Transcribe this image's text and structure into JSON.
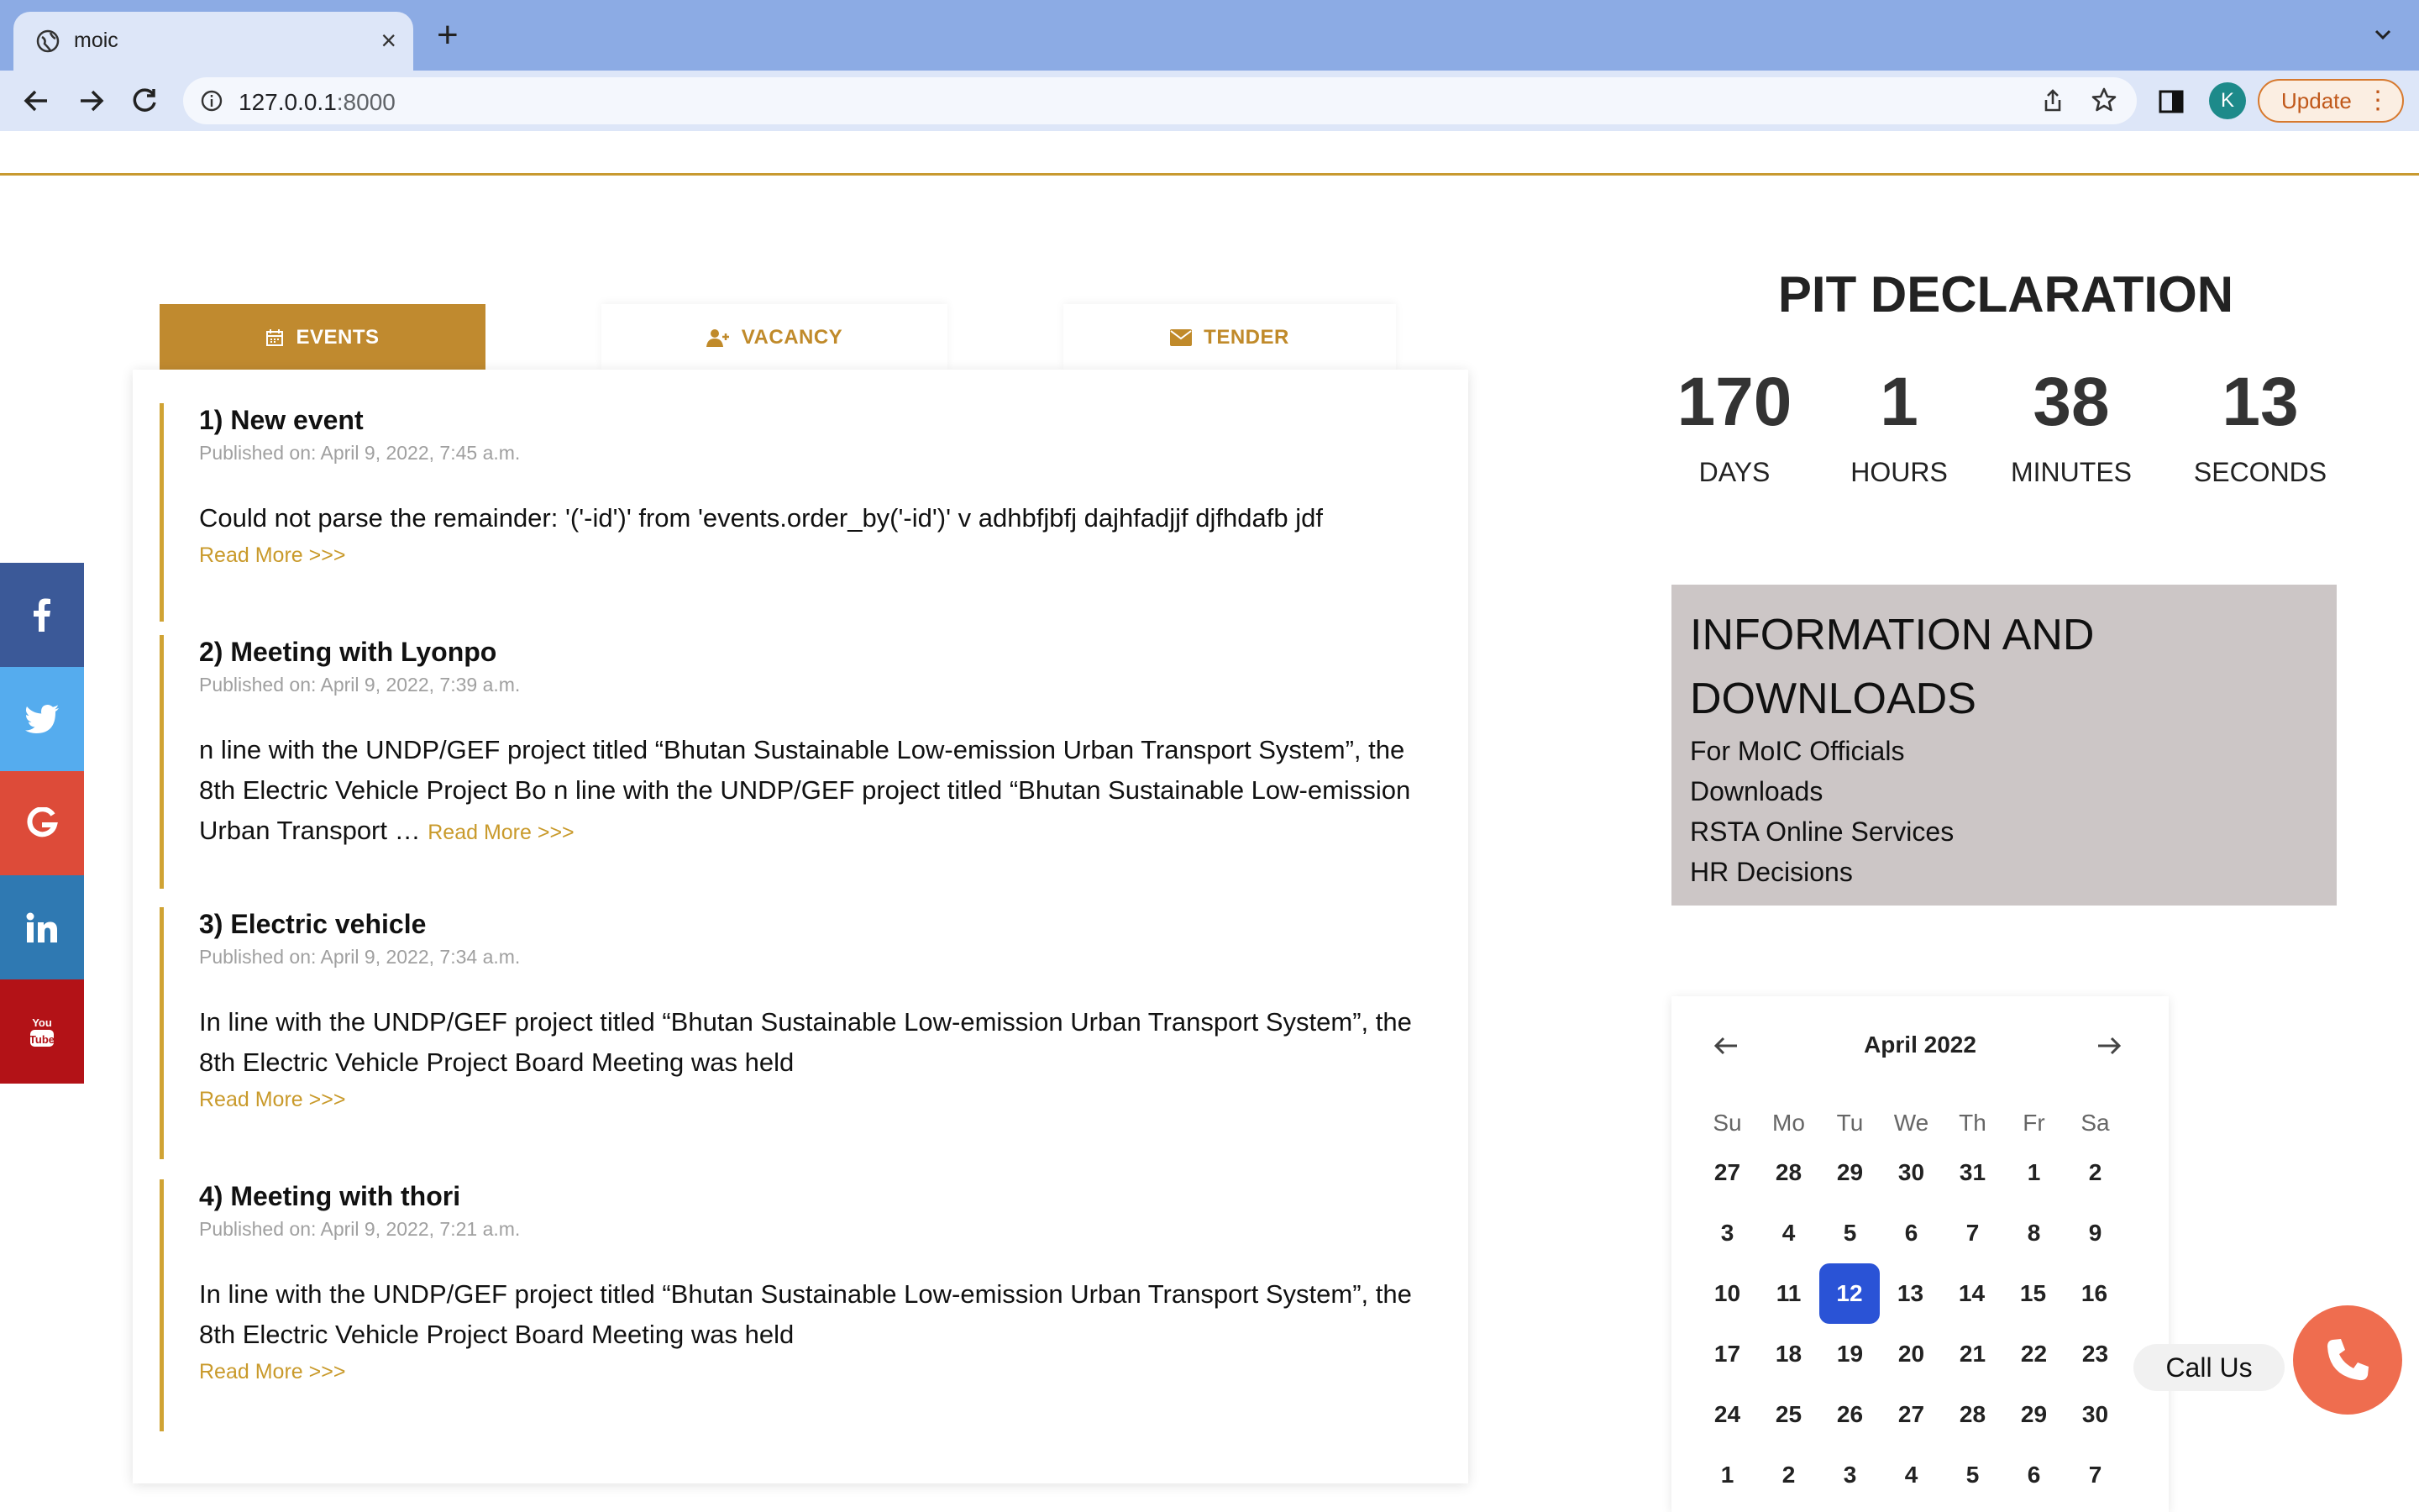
{
  "browser": {
    "tab_title": "moic",
    "url_host": "127.0.0.1",
    "url_port": ":8000",
    "avatar_letter": "K",
    "update_label": "Update"
  },
  "tabs": [
    {
      "label": "EVENTS",
      "icon": "calendar-icon",
      "active": true
    },
    {
      "label": "VACANCY",
      "icon": "user-plus-icon",
      "active": false
    },
    {
      "label": "TENDER",
      "icon": "envelope-icon",
      "active": false
    }
  ],
  "events": [
    {
      "title": "1) New event",
      "published": "Published on: April 9, 2022, 7:45 a.m.",
      "body": "Could not parse the remainder: '('-id')' from 'events.order_by('-id')' v adhbfjbfj dajhfadjjf djfhdafb jdf",
      "read_more": "Read More >>>"
    },
    {
      "title": "2) Meeting with Lyonpo",
      "published": "Published on: April 9, 2022, 7:39 a.m.",
      "body": "n line with the UNDP/GEF project titled “Bhutan Sustainable Low-emission Urban Transport System”, the 8th Electric Vehicle Project Bo n line with the UNDP/GEF project titled “Bhutan Sustainable Low-emission Urban Transport …",
      "read_more": "Read More >>>"
    },
    {
      "title": "3) Electric vehicle",
      "published": "Published on: April 9, 2022, 7:34 a.m.",
      "body": "In line with the UNDP/GEF project titled “Bhutan Sustainable Low-emission Urban Transport System”, the 8th Electric Vehicle Project Board Meeting was held",
      "read_more": "Read More >>>"
    },
    {
      "title": "4) Meeting with thori",
      "published": "Published on: April 9, 2022, 7:21 a.m.",
      "body": "In line with the UNDP/GEF project titled “Bhutan Sustainable Low-emission Urban Transport System”, the 8th Electric Vehicle Project Board Meeting was held",
      "read_more": "Read More >>>"
    }
  ],
  "pit": {
    "title": "PIT DECLARATION",
    "countdown": [
      {
        "value": "170",
        "label": "DAYS"
      },
      {
        "value": "1",
        "label": "HOURS"
      },
      {
        "value": "38",
        "label": "MINUTES"
      },
      {
        "value": "13",
        "label": "SECONDS"
      }
    ]
  },
  "info": {
    "heading": "INFORMATION AND DOWNLOADS",
    "links": [
      "For MoIC Officials",
      "Downloads",
      "RSTA Online Services",
      "HR Decisions"
    ]
  },
  "calendar": {
    "month": "April 2022",
    "weekdays": [
      "Su",
      "Mo",
      "Tu",
      "We",
      "Th",
      "Fr",
      "Sa"
    ],
    "weeks": [
      [
        "27",
        "28",
        "29",
        "30",
        "31",
        "1",
        "2"
      ],
      [
        "3",
        "4",
        "5",
        "6",
        "7",
        "8",
        "9"
      ],
      [
        "10",
        "11",
        "12",
        "13",
        "14",
        "15",
        "16"
      ],
      [
        "17",
        "18",
        "19",
        "20",
        "21",
        "22",
        "23"
      ],
      [
        "24",
        "25",
        "26",
        "27",
        "28",
        "29",
        "30"
      ],
      [
        "1",
        "2",
        "3",
        "4",
        "5",
        "6",
        "7"
      ]
    ],
    "today": "12"
  },
  "social": [
    {
      "name": "facebook",
      "glyph": "f",
      "color": "#3b5998"
    },
    {
      "name": "twitter",
      "glyph": "t",
      "color": "#55acee"
    },
    {
      "name": "google",
      "glyph": "G",
      "color": "#dd4b39"
    },
    {
      "name": "linkedin",
      "glyph": "in",
      "color": "#2f79b2"
    },
    {
      "name": "youtube",
      "glyph": "You Tube",
      "color": "#b31217"
    }
  ],
  "contact": {
    "call_label": "Call Us"
  },
  "colors": {
    "gold": "#c08a2f",
    "today": "#2a53d6",
    "call": "#ef6d4f"
  }
}
